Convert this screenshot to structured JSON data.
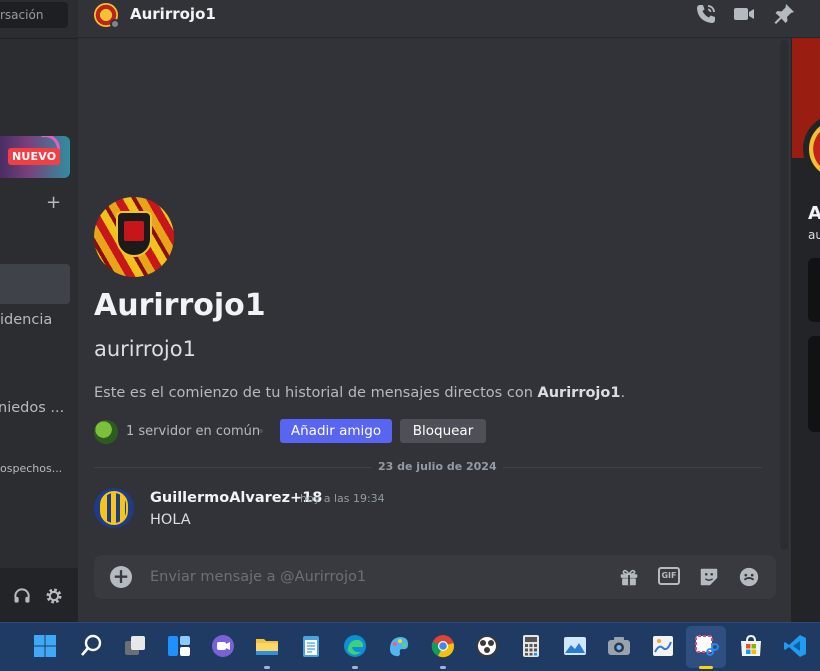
{
  "sidebar": {
    "search_text": "rsación",
    "promo_badge": "NUEVO",
    "add_label": "+",
    "items": [
      {
        "label": "idencia"
      },
      {
        "label": "niedos ..."
      },
      {
        "label": "ospechos..."
      }
    ]
  },
  "header": {
    "title": "Aurirrojo1",
    "icons": [
      "phone-call-icon",
      "video-call-icon",
      "pin-icon"
    ]
  },
  "profile": {
    "display_name": "Aurirrojo1",
    "username": "aurirrojo1",
    "intro_prefix": "Este es el comienzo de tu historial de mensajes directos con ",
    "intro_name": "Aurirrojo1",
    "intro_suffix": ".",
    "mutual_servers": "1 servidor en común",
    "add_friend_label": "Añadir amigo",
    "block_label": "Bloquear"
  },
  "divider": {
    "date": "23 de julio de 2024"
  },
  "messages": [
    {
      "author": "GuillermoAlvarez+18",
      "time": "hoy a las 19:34",
      "text": "HOLA"
    }
  ],
  "composer": {
    "placeholder": "Enviar mensaje a @Aurirrojo1",
    "gif_label": "GIF",
    "icons": [
      "add-icon",
      "gift-icon",
      "gif-icon",
      "sticker-icon",
      "emoji-icon"
    ]
  },
  "right_panel": {
    "name": "A",
    "username": "au"
  },
  "taskbar": {
    "apps": [
      "windows-start-icon",
      "search-icon",
      "task-view-icon",
      "widgets-icon",
      "teams-chat-icon",
      "file-explorer-icon",
      "notepad-icon",
      "edge-icon",
      "paint-3d-icon",
      "chrome-icon",
      "obs-icon",
      "calculator-icon",
      "photos-icon",
      "camera-icon",
      "paint-icon",
      "snipping-tool-icon",
      "microsoft-store-icon",
      "vscode-icon"
    ]
  },
  "colors": {
    "accent": "#5865f2",
    "background": "#313338",
    "sidebar": "#2b2d31",
    "taskbar": "#1f3b63"
  }
}
